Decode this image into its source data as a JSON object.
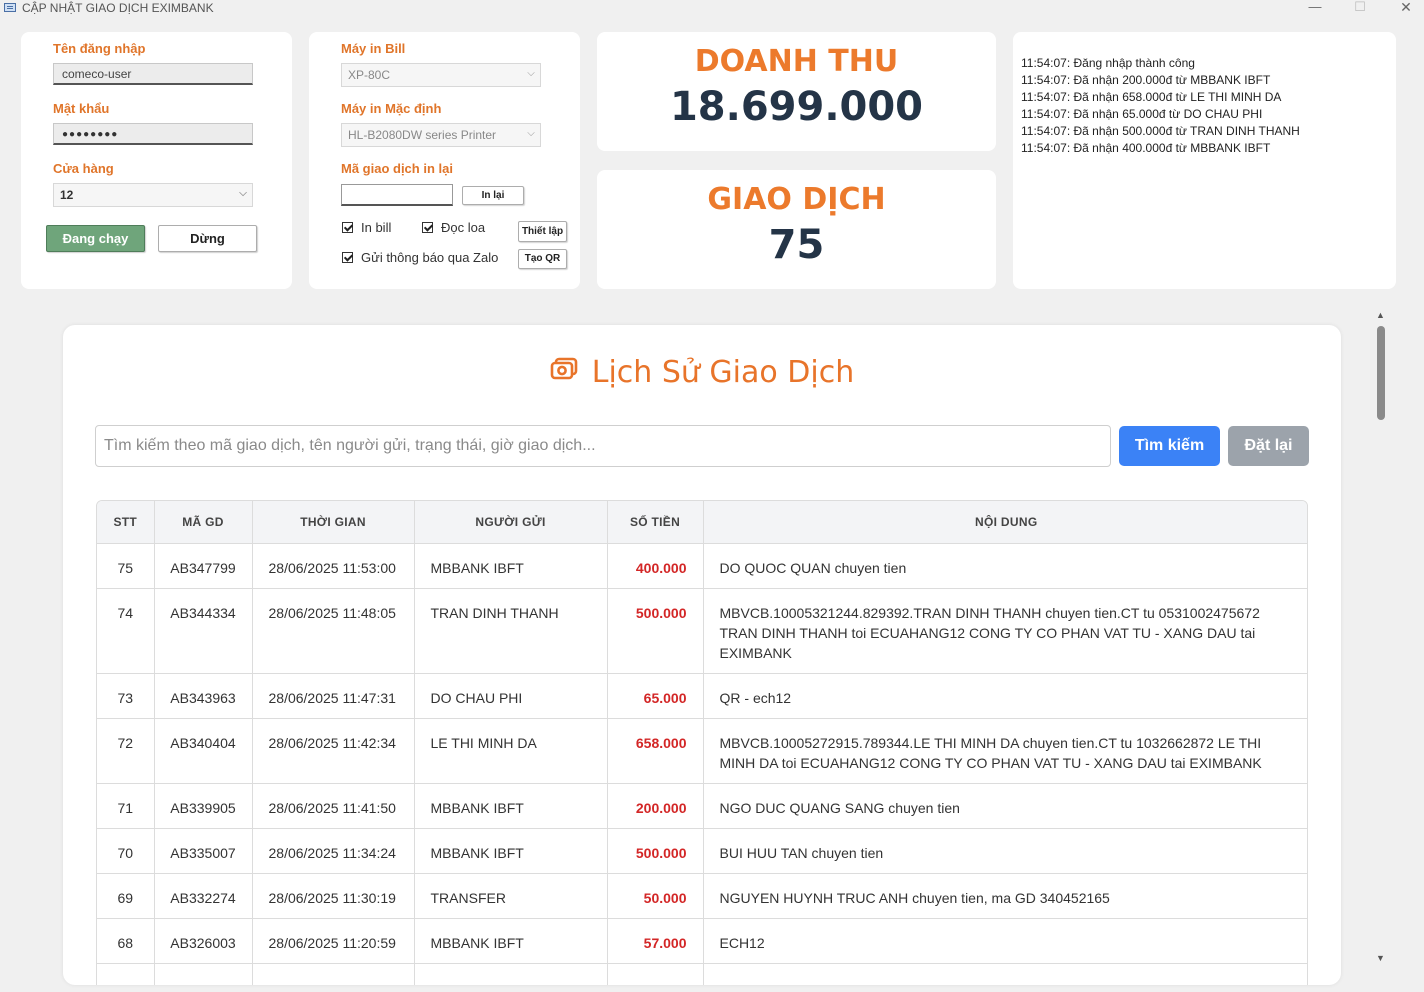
{
  "window": {
    "title": "CẬP NHẬT GIAO DỊCH EXIMBANK",
    "minimize": "—",
    "maximize": "☐",
    "close": "✕"
  },
  "login": {
    "username_label": "Tên đăng nhập",
    "username_value": "comeco-user",
    "password_label": "Mật khẩu",
    "password_value": "●●●●●●●●",
    "store_label": "Cửa hàng",
    "store_value": "12",
    "running_button": "Đang chạy",
    "stop_button": "Dừng"
  },
  "printer": {
    "bill_printer_label": "Máy in Bill",
    "bill_printer_value": "XP-80C",
    "default_printer_label": "Máy in Mặc định",
    "default_printer_value": "HL-B2080DW series Printer",
    "reprint_label": "Mã giao dịch in lại",
    "reprint_value": "",
    "reprint_button": "In lại",
    "print_bill_label": "In bill",
    "speaker_label": "Đọc loa",
    "setup_button": "Thiết lập",
    "zalo_label": "Gửi thông báo qua Zalo",
    "qr_button": "Tạo QR"
  },
  "stats": {
    "revenue_label": "DOANH THU",
    "revenue_value": "18.699.000",
    "transactions_label": "GIAO DỊCH",
    "transactions_value": "75"
  },
  "log": [
    "11:54:07: Đăng nhập thành công",
    "11:54:07: Đã nhận 200.000đ từ MBBANK IBFT",
    "11:54:07: Đã nhận 658.000đ từ LE THI MINH DA",
    "11:54:07: Đã nhận 65.000đ từ DO CHAU PHI",
    "11:54:07: Đã nhận 500.000đ từ TRAN DINH THANH",
    "11:54:07: Đã nhận 400.000đ từ MBBANK IBFT"
  ],
  "history": {
    "title": "Lịch Sử Giao Dịch",
    "search_placeholder": "Tìm kiếm theo mã giao dịch, tên người gửi, trạng thái, giờ giao dịch...",
    "search_button": "Tìm kiếm",
    "reset_button": "Đặt lại",
    "columns": [
      "STT",
      "MÃ GD",
      "THỜI GIAN",
      "NGƯỜI GỬI",
      "SỐ TIỀN",
      "NỘI DUNG"
    ],
    "rows": [
      {
        "stt": "75",
        "ma": "AB347799",
        "time": "28/06/2025 11:53:00",
        "sender": "MBBANK IBFT",
        "amount": "400.000",
        "content": "DO QUOC QUAN chuyen tien"
      },
      {
        "stt": "74",
        "ma": "AB344334",
        "time": "28/06/2025 11:48:05",
        "sender": "TRAN DINH THANH",
        "amount": "500.000",
        "content": "MBVCB.10005321244.829392.TRAN DINH THANH chuyen tien.CT tu 0531002475672 TRAN DINH THANH toi ECUAHANG12 CONG TY CO PHAN VAT TU - XANG DAU tai EXIMBANK"
      },
      {
        "stt": "73",
        "ma": "AB343963",
        "time": "28/06/2025 11:47:31",
        "sender": "DO CHAU PHI",
        "amount": "65.000",
        "content": "QR - ech12"
      },
      {
        "stt": "72",
        "ma": "AB340404",
        "time": "28/06/2025 11:42:34",
        "sender": "LE THI MINH DA",
        "amount": "658.000",
        "content": "MBVCB.10005272915.789344.LE THI MINH DA chuyen tien.CT tu 1032662872 LE THI MINH DA toi ECUAHANG12 CONG TY CO PHAN VAT TU - XANG DAU tai EXIMBANK"
      },
      {
        "stt": "71",
        "ma": "AB339905",
        "time": "28/06/2025 11:41:50",
        "sender": "MBBANK IBFT",
        "amount": "200.000",
        "content": "NGO DUC QUANG SANG chuyen tien"
      },
      {
        "stt": "70",
        "ma": "AB335007",
        "time": "28/06/2025 11:34:24",
        "sender": "MBBANK IBFT",
        "amount": "500.000",
        "content": "BUI HUU TAN chuyen tien"
      },
      {
        "stt": "69",
        "ma": "AB332274",
        "time": "28/06/2025 11:30:19",
        "sender": "TRANSFER",
        "amount": "50.000",
        "content": "NGUYEN HUYNH TRUC ANH chuyen tien, ma GD 340452165"
      },
      {
        "stt": "68",
        "ma": "AB326003",
        "time": "28/06/2025 11:20:59",
        "sender": "MBBANK IBFT",
        "amount": "57.000",
        "content": "ECH12"
      },
      {
        "stt": "",
        "ma": "",
        "time": "",
        "sender": "",
        "amount": "",
        "content": ""
      }
    ]
  },
  "colors": {
    "accent_orange": "#e8742a",
    "running_green": "#6fa57b",
    "search_blue": "#3b82f6",
    "reset_gray": "#9ca3ab",
    "amount_red": "#d32626",
    "stat_dark": "#243447"
  },
  "icons": {
    "history": "camera-icon",
    "scroll_up": "scroll-up-arrow-icon",
    "scroll_down": "scroll-down-arrow-icon"
  }
}
